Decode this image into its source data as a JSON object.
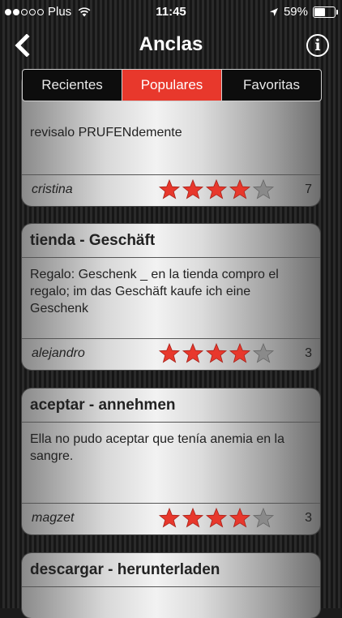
{
  "status_bar": {
    "carrier": "Plus",
    "time": "11:45",
    "battery": "59%",
    "battery_level": 0.59
  },
  "nav": {
    "title": "Anclas",
    "back_icon": "chevron-left-icon",
    "info_icon": "info-icon"
  },
  "tabs": [
    {
      "label": "Recientes",
      "active": false
    },
    {
      "label": "Populares",
      "active": true
    },
    {
      "label": "Favoritas",
      "active": false
    }
  ],
  "colors": {
    "accent": "#e8382c",
    "star_on": "#e8382c",
    "star_off": "#8a8a8a"
  },
  "cards": [
    {
      "body": "revisalo PRUFENdemente",
      "author": "cristina",
      "rating": 4,
      "count": "7"
    },
    {
      "title": "tienda - Geschäft",
      "body": "Regalo: Geschenk  _ en la tienda compro el regalo; im das Geschäft kaufe ich eine Geschenk",
      "author": "alejandro",
      "rating": 4,
      "count": "3"
    },
    {
      "title": "aceptar - annehmen",
      "body": "Ella no pudo aceptar que tenía anemia en la sangre.",
      "author": "magzet",
      "rating": 4,
      "count": "3"
    },
    {
      "title": "descargar - herunterladen"
    }
  ]
}
